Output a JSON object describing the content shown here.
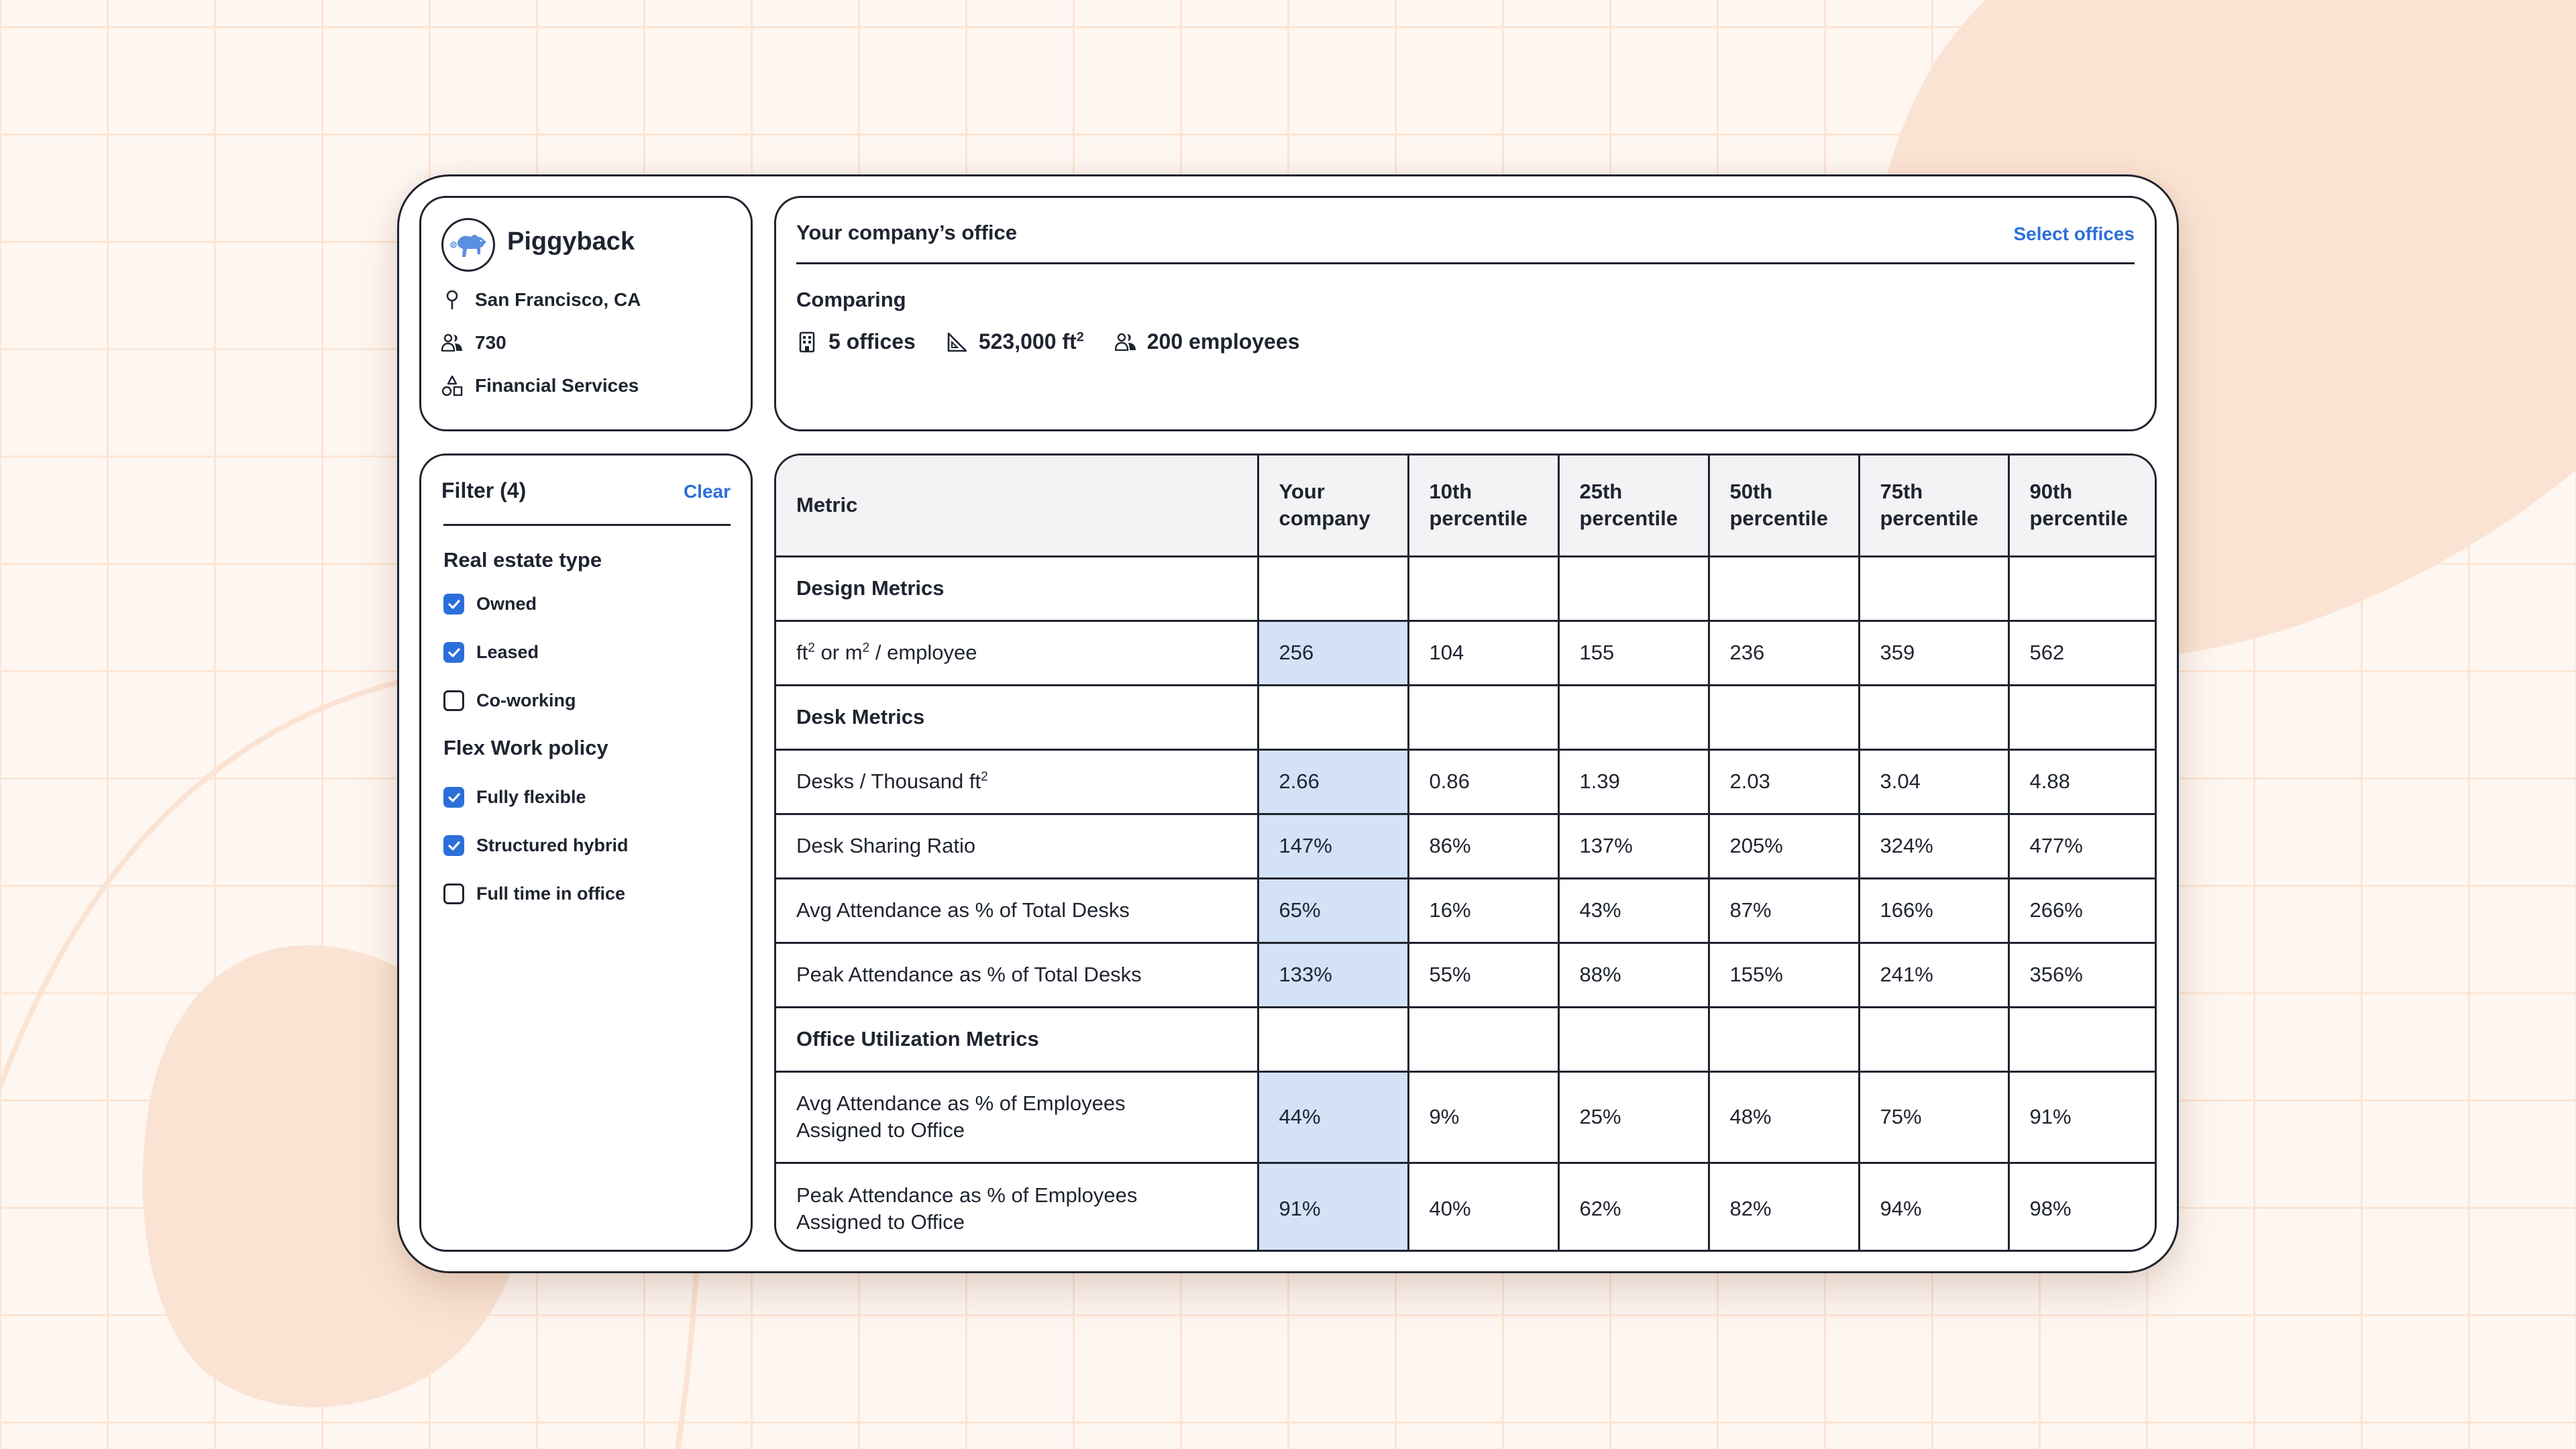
{
  "company": {
    "name": "Piggyback",
    "logo_icon": "flying-pig-logo",
    "location": "San Francisco, CA",
    "employees": "730",
    "industry": "Financial Services"
  },
  "filter": {
    "title": "Filter (4)",
    "clear_label": "Clear",
    "groups": [
      {
        "title": "Real estate type",
        "options": [
          {
            "label": "Owned",
            "checked": true
          },
          {
            "label": "Leased",
            "checked": true
          },
          {
            "label": "Co-working",
            "checked": false
          }
        ]
      },
      {
        "title": "Flex Work policy",
        "options": [
          {
            "label": "Fully flexible",
            "checked": true
          },
          {
            "label": "Structured hybrid",
            "checked": true
          },
          {
            "label": "Full time in office",
            "checked": false
          }
        ]
      }
    ]
  },
  "office": {
    "title": "Your company’s office",
    "select_label": "Select offices",
    "comparing_label": "Comparing",
    "stats": [
      {
        "icon": "building-icon",
        "text": "5 offices"
      },
      {
        "icon": "area-ruler-icon",
        "text": "523,000 ft²"
      },
      {
        "icon": "people-icon",
        "text": "200 employees"
      }
    ]
  },
  "table": {
    "columns": [
      "Metric",
      "Your company",
      "10th percentile",
      "25th percentile",
      "50th percentile",
      "75th percentile",
      "90th percentile"
    ],
    "column_lines": [
      [
        "Metric"
      ],
      [
        "Your",
        "company"
      ],
      [
        "10th",
        "percentile"
      ],
      [
        "25th",
        "percentile"
      ],
      [
        "50th",
        "percentile"
      ],
      [
        "75th",
        "percentile"
      ],
      [
        "90th",
        "percentile"
      ]
    ],
    "rows": [
      {
        "type": "section",
        "label": "Design Metrics"
      },
      {
        "type": "data",
        "label": "ft² or m² / employee",
        "values": [
          "256",
          "104",
          "155",
          "236",
          "359",
          "562"
        ]
      },
      {
        "type": "section",
        "label": "Desk Metrics"
      },
      {
        "type": "data",
        "label": "Desks / Thousand ft²",
        "values": [
          "2.66",
          "0.86",
          "1.39",
          "2.03",
          "3.04",
          "4.88"
        ]
      },
      {
        "type": "data",
        "label": "Desk Sharing Ratio",
        "values": [
          "147%",
          "86%",
          "137%",
          "205%",
          "324%",
          "477%"
        ]
      },
      {
        "type": "data",
        "label": "Avg Attendance as % of Total Desks",
        "values": [
          "65%",
          "16%",
          "43%",
          "87%",
          "166%",
          "266%"
        ]
      },
      {
        "type": "data",
        "label": "Peak Attendance as % of Total Desks",
        "values": [
          "133%",
          "55%",
          "88%",
          "155%",
          "241%",
          "356%"
        ]
      },
      {
        "type": "section",
        "label": "Office Utilization Metrics"
      },
      {
        "type": "data",
        "label": "Avg Attendance as % of Employees Assigned to Office",
        "label_lines": [
          "Avg Attendance as % of Employees",
          "Assigned to Office"
        ],
        "values": [
          "44%",
          "9%",
          "25%",
          "48%",
          "75%",
          "91%"
        ]
      },
      {
        "type": "data",
        "label": "Peak Attendance as % of Employees Assigned to Office",
        "label_lines": [
          "Peak Attendance as % of Employees",
          "Assigned to Office"
        ],
        "values": [
          "91%",
          "40%",
          "62%",
          "82%",
          "94%",
          "98%"
        ]
      }
    ]
  },
  "colors": {
    "accent": "#2b6fd9",
    "highlight_cell": "#d3e2f7",
    "header_bg": "#f3f3f6",
    "border": "#1f2430",
    "background": "#fef6f1",
    "blob": "#fbe3d3"
  }
}
